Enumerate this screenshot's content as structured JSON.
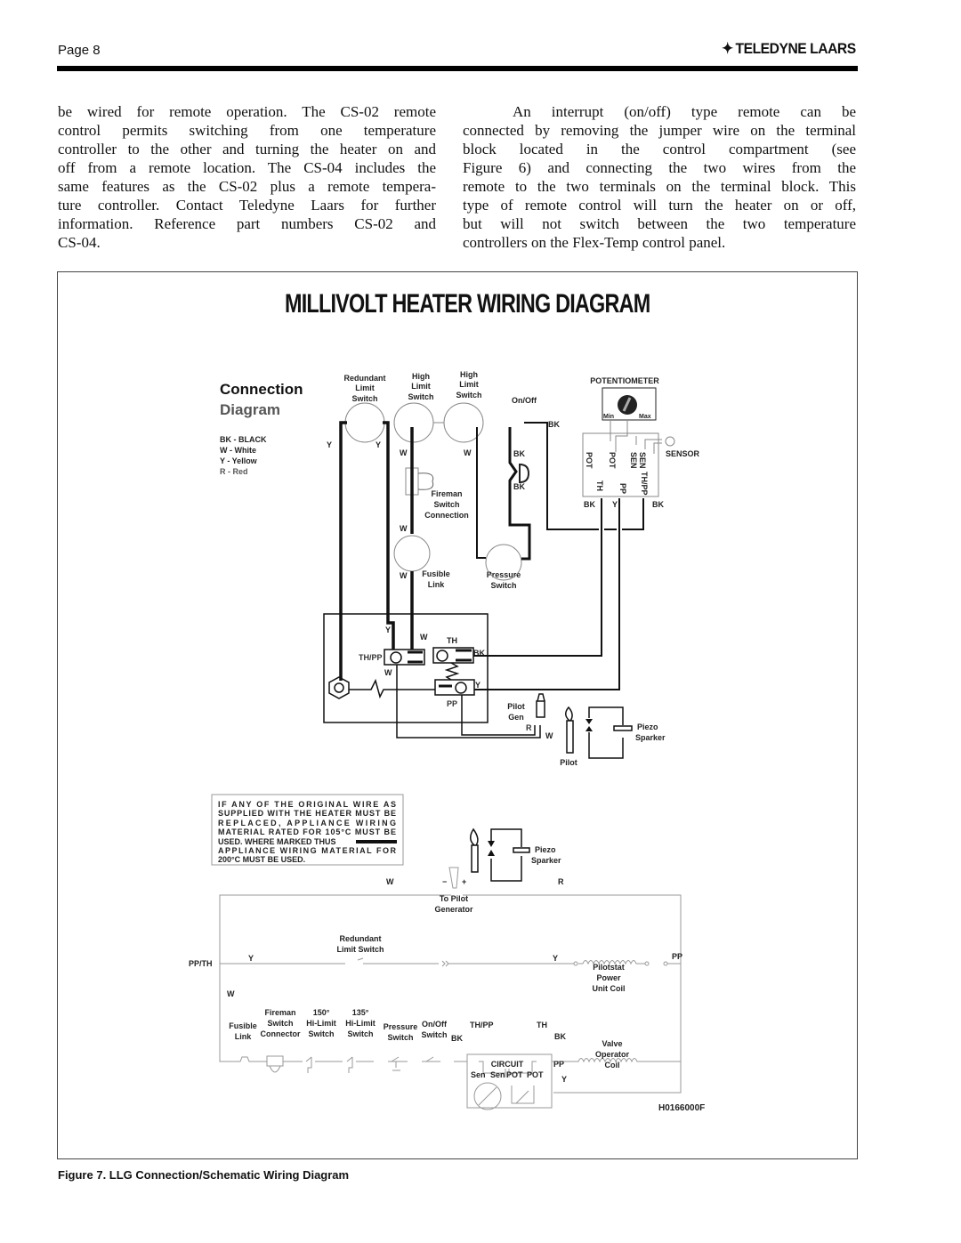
{
  "header": {
    "page": "Page 8",
    "brand": "TELEDYNE LAARS"
  },
  "body": {
    "left": [
      "be wired for remote operation. The CS-02 remote",
      "control permits switching from one temperature",
      "controller to the other and turning the heater on and",
      "off from a remote location. The CS-04 includes the",
      "same features as the CS-02 plus a remote tempera-",
      "ture controller. Contact Teledyne Laars for further",
      "information. Reference part numbers CS-02 and",
      "CS-04."
    ],
    "right": [
      "An interrupt (on/off) type remote can be",
      "connected by removing the jumper wire on the terminal",
      "block located in the control compartment (see",
      "Figure 6) and connecting the two wires from the",
      "remote to the two terminals on the terminal block. This",
      "type of remote control will turn the heater on or off,",
      "but will not switch between the two temperature",
      "controllers on the Flex-Temp control panel."
    ]
  },
  "diagram": {
    "title": "MILLIVOLT HEATER WIRING DIAGRAM",
    "connection": {
      "heading1": "Connection",
      "heading2": "Diagram",
      "legend": [
        "BK - BLACK",
        "W  - White",
        "Y  - Yellow",
        "R  - Red"
      ],
      "redundant": [
        "Redundant",
        "Limit",
        "Switch"
      ],
      "high1": [
        "High",
        "Limit",
        "Switch"
      ],
      "high2": [
        "High",
        "Limit",
        "Switch"
      ],
      "onoff": "On/Off",
      "potentiometer": "POTENTIOMETER",
      "min": "Min",
      "max": "Max",
      "sensor": "SENSOR",
      "term_top": [
        "POT",
        "POT",
        "SEN",
        "SEN"
      ],
      "term_bottom": [
        "TH",
        "PP",
        "TH/PP"
      ],
      "fireman": [
        "Fireman",
        "Switch",
        "Connection"
      ],
      "fusible": [
        "Fusible",
        "Link"
      ],
      "pressure": [
        "Pressure",
        "Switch"
      ],
      "pilot_gen": [
        "Pilot",
        "Gen"
      ],
      "pilot": "Pilot",
      "piezo": [
        "Piezo",
        "Sparker"
      ],
      "th_pp": "TH/PP",
      "th": "TH",
      "pp": "PP",
      "wire": {
        "Y": "Y",
        "W": "W",
        "BK": "BK",
        "R": "R"
      }
    },
    "warning": [
      "IF ANY OF THE ORIGINAL WIRE AS",
      "SUPPLIED WITH THE HEATER MUST BE",
      "REPLACED, APPLIANCE WIRING",
      "MATERIAL RATED FOR 105°C MUST BE",
      "USED. WHERE MARKED THUS",
      "APPLIANCE WIRING MATERIAL FOR",
      "200°C MUST BE USED."
    ],
    "schematic": {
      "piezo": [
        "Piezo",
        "Sparker"
      ],
      "to_pilot": [
        "To Pilot",
        "Generator"
      ],
      "minus": "−",
      "plus": "+",
      "redundant": [
        "Redundant",
        "Limit Switch"
      ],
      "pp_th": "PP/TH",
      "pp": "PP",
      "pilotstat": [
        "Pilotstat",
        "Power",
        "Unit Coil"
      ],
      "fusible": [
        "Fusible",
        "Link"
      ],
      "fireman": [
        "Fireman",
        "Switch",
        "Connector"
      ],
      "hi150": [
        "150°",
        "Hi-Limit",
        "Switch"
      ],
      "hi135": [
        "135°",
        "Hi-Limit",
        "Switch"
      ],
      "pressure": [
        "Pressure",
        "Switch"
      ],
      "onoff": [
        "On/Off",
        "Switch"
      ],
      "th_pp": "TH/PP",
      "th": "TH",
      "valve": [
        "Valve",
        "Operator",
        "Coil"
      ],
      "circuit": "CIRCUIT",
      "circuit_pp": "PP",
      "circuit_terms": [
        "Sen",
        "Sen",
        "POT",
        "POT"
      ]
    },
    "drawing_number": "H0166000F"
  },
  "caption": "Figure 7. LLG Connection/Schematic Wiring Diagram"
}
